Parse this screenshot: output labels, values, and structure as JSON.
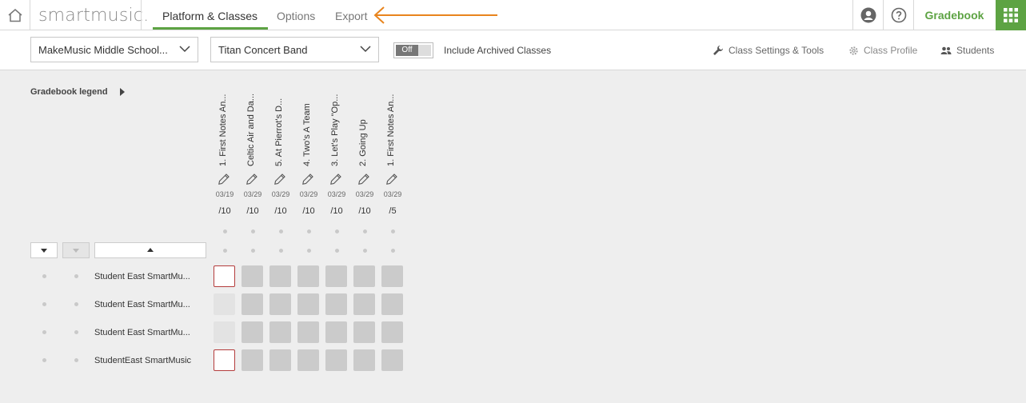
{
  "nav": {
    "brand": "smartmusic.",
    "tabs": [
      {
        "label": "Platform & Classes",
        "active": true
      },
      {
        "label": "Options",
        "active": false
      },
      {
        "label": "Export",
        "active": false
      }
    ],
    "gradebook_label": "Gradebook"
  },
  "filters": {
    "school": "MakeMusic Middle School...",
    "class": "Titan Concert Band",
    "toggle_label": "Off",
    "archived_label": "Include Archived Classes",
    "links": {
      "settings": "Class Settings & Tools",
      "profile": "Class Profile",
      "students": "Students"
    }
  },
  "gradebook": {
    "legend_label": "Gradebook legend",
    "assignments": [
      {
        "title": "1. First Notes An...",
        "date": "03/19",
        "points": "/10"
      },
      {
        "title": "Celtic Air and Da...",
        "date": "03/29",
        "points": "/10"
      },
      {
        "title": "5. At Pierrot's D...",
        "date": "03/29",
        "points": "/10"
      },
      {
        "title": "4. Two's A Team",
        "date": "03/29",
        "points": "/10"
      },
      {
        "title": "3. Let's Play \"Op...",
        "date": "03/29",
        "points": "/10"
      },
      {
        "title": "2. Going Up",
        "date": "03/29",
        "points": "/10"
      },
      {
        "title": "1. First Notes An...",
        "date": "03/29",
        "points": "/5"
      }
    ],
    "students": [
      {
        "name": "Student East SmartMu...",
        "first_cell": "outlined-red"
      },
      {
        "name": "Student East SmartMu...",
        "first_cell": "light"
      },
      {
        "name": "Student East SmartMu...",
        "first_cell": "light"
      },
      {
        "name": "StudentEast SmartMusic",
        "first_cell": "outlined-red"
      }
    ]
  },
  "colors": {
    "accent": "#5da343",
    "annotation_arrow": "#e8841d",
    "cell_fill": "#cbcbcb",
    "cell_outline": "#b43c3c"
  }
}
